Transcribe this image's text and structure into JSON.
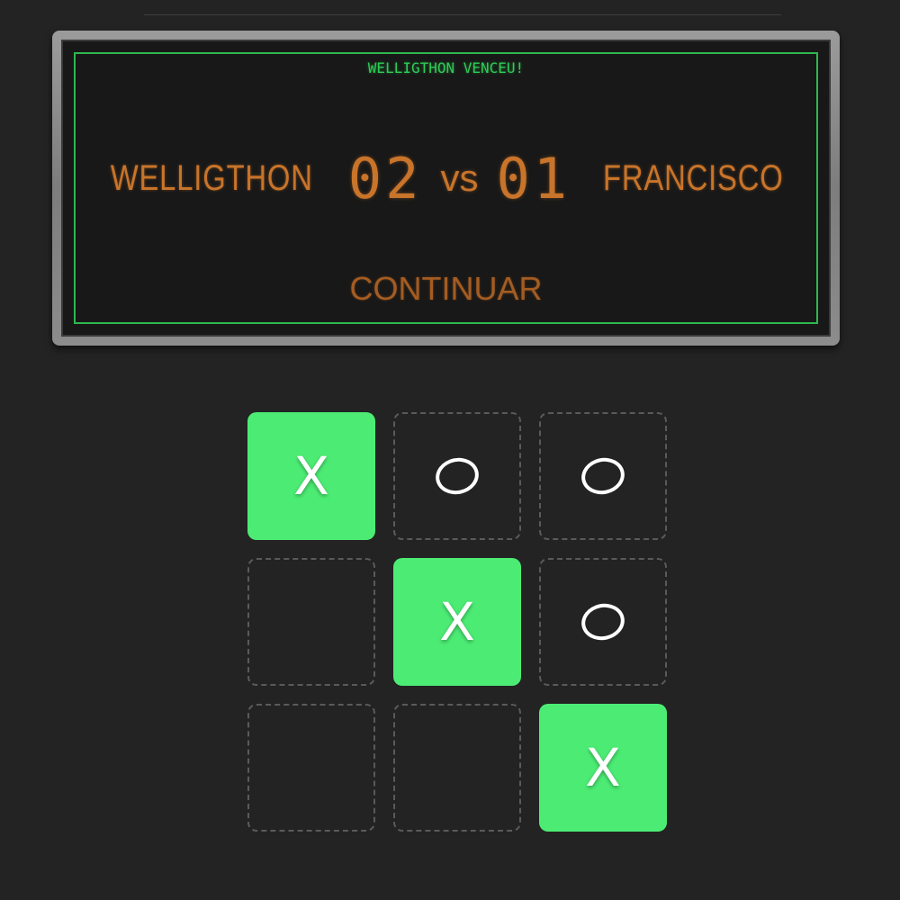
{
  "scoreboard": {
    "winner_message": "WELLIGTHON VENCEU!",
    "player1": {
      "name": "WELLIGTHON",
      "score": "02"
    },
    "vs_label": "vs",
    "player2": {
      "name": "FRANCISCO",
      "score": "01"
    },
    "continue_label": "CONTINUAR"
  },
  "board": {
    "cells": [
      {
        "mark": "X",
        "winning": true
      },
      {
        "mark": "O",
        "winning": false
      },
      {
        "mark": "O",
        "winning": false
      },
      {
        "mark": "",
        "winning": false
      },
      {
        "mark": "X",
        "winning": true
      },
      {
        "mark": "O",
        "winning": false
      },
      {
        "mark": "",
        "winning": false
      },
      {
        "mark": "",
        "winning": false
      },
      {
        "mark": "X",
        "winning": true
      }
    ]
  },
  "colors": {
    "background": "#232323",
    "win_cell": "#4cec74",
    "led_green": "#2ecc55",
    "led_orange": "#c8742a"
  }
}
